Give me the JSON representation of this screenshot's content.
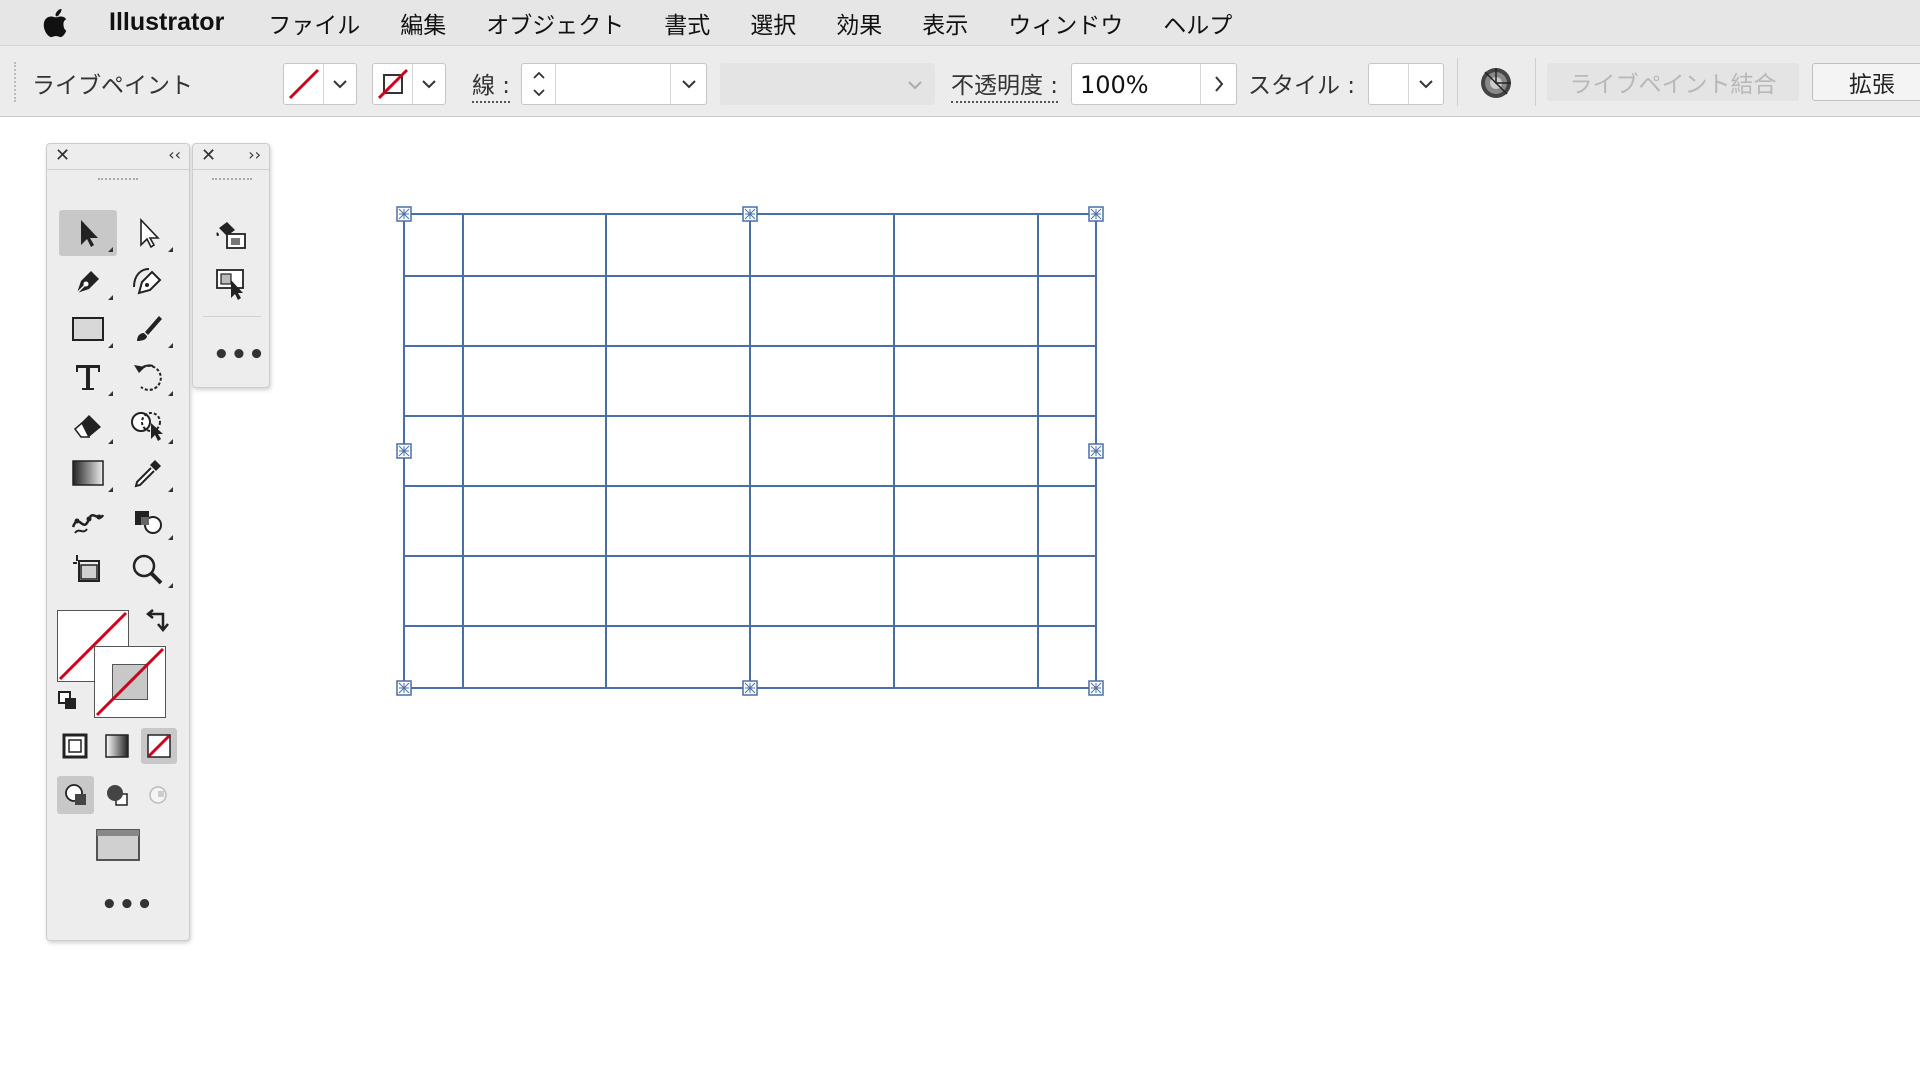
{
  "menubar": {
    "app_name": "Illustrator",
    "items": [
      "ファイル",
      "編集",
      "オブジェクト",
      "書式",
      "選択",
      "効果",
      "表示",
      "ウィンドウ",
      "ヘルプ"
    ]
  },
  "controlbar": {
    "tool_name": "ライブペイント",
    "stroke_label": "線 :",
    "stroke_value": "",
    "opacity_label": "不透明度 :",
    "opacity_value": "100%",
    "style_label": "スタイル :",
    "merge_button": "ライブペイント結合",
    "expand_button": "拡張"
  },
  "toolbar_left": {
    "tools": [
      "selection-tool",
      "direct-selection-tool",
      "pen-tool",
      "curvature-tool",
      "rectangle-tool",
      "paintbrush-tool",
      "type-tool",
      "rotate-tool",
      "eraser-tool",
      "shape-builder-tool",
      "gradient-tool",
      "eyedropper-tool",
      "puppet-warp-tool",
      "live-paint-bucket-tool",
      "artboard-tool",
      "zoom-tool"
    ],
    "selected": "selection-tool"
  },
  "toolbar_right": {
    "tools": [
      "live-paint-bucket-tool",
      "live-paint-selection-tool"
    ]
  },
  "colors": {
    "selection": "#4a6fa5",
    "none_slash": "#d0021b",
    "panel_bg": "#ededed",
    "menubar_bg": "#e6e6e6"
  },
  "artwork": {
    "type": "live-paint-grid",
    "columns": 6,
    "rows": 7
  }
}
